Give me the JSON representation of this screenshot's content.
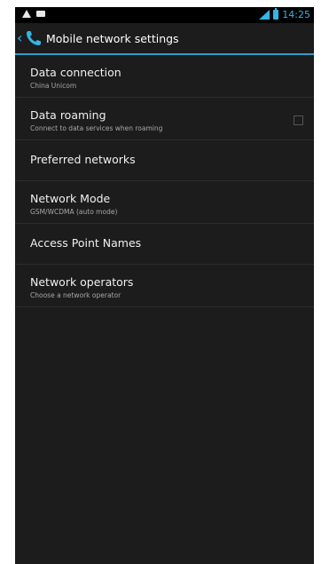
{
  "status_bar": {
    "left_icons": [
      "warning-icon",
      "message-icon"
    ],
    "right_icons": [
      "signal-icon",
      "battery-icon"
    ],
    "time": "14:25"
  },
  "action_bar": {
    "title": "Mobile network settings",
    "icon": "phone-icon"
  },
  "colors": {
    "accent": "#33b5e5",
    "background": "#1c1c1c",
    "status_bar": "#000000"
  },
  "settings": [
    {
      "title": "Data connection",
      "summary": "China Unicom"
    },
    {
      "title": "Data roaming",
      "summary": "Connect to data services when roaming",
      "checkbox": false
    },
    {
      "title": "Preferred networks"
    },
    {
      "title": "Network Mode",
      "summary": "GSM/WCDMA (auto mode)"
    },
    {
      "title": "Access Point Names"
    },
    {
      "title": "Network operators",
      "summary": "Choose a network operator"
    }
  ]
}
